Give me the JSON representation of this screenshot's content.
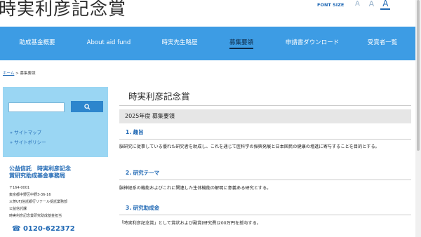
{
  "header": {
    "site_title": "時実利彦記念賞",
    "font_size_label": "FONT SIZE",
    "font_sizes": [
      "A",
      "A",
      "A"
    ]
  },
  "nav": {
    "items": [
      "助成基金概要",
      "About aid fund",
      "時実先生略歴",
      "募集要領",
      "申請書ダウンロード",
      "受賞者一覧"
    ],
    "active_index": 3
  },
  "breadcrumb": {
    "home": "ホーム",
    "separator": " > ",
    "current": "募集要領"
  },
  "sidebar": {
    "search_placeholder": "",
    "search_icon": "search-icon",
    "links": [
      "サイトマップ",
      "サイトポリシー"
    ],
    "link_bullet": "»",
    "office_name_line1": "公益信託　時実利彦記念",
    "office_name_line2": "賞研究助成基金事務局",
    "address_lines": [
      "〒164-0001",
      "東京都中野区中野3-36-16",
      "三菱UFJ信託銀行リテール受託業務部",
      "公益信託課",
      "時実利彦記念賞研究助成基金担当"
    ],
    "phone_icon": "☎",
    "phone": "0120-622372"
  },
  "main": {
    "page_title": "時実利彦記念賞",
    "year_heading": "2025年度 募集要領",
    "sections": [
      {
        "heading": "1. 趣旨",
        "body": "脳研究に従事している優れた研究者を助成し、これを通じて医科学の振興発展と日本国民の健康の増進に寄与することを目的とする。"
      },
      {
        "heading": "2. 研究テーマ",
        "body": "脳神経系の機能およびこれに関連した生体機能の解明に意義ある研究とする。"
      },
      {
        "heading": "3. 研究助成金",
        "body": "「時実利彦記念賞」として賞状および副賞(研究費)200万円を授与する。"
      }
    ]
  },
  "colors": {
    "nav_bg": "#3d9ce4",
    "sidebar_bg": "#9ad6f3",
    "accent_blue": "#1f68b4",
    "search_button": "#2d86cd"
  }
}
